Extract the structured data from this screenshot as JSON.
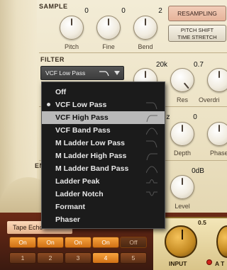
{
  "sample": {
    "section_label": "SAMPLE",
    "knobs": [
      {
        "label": "Pitch",
        "value": "0"
      },
      {
        "label": "Fine",
        "value": "0"
      },
      {
        "label": "Bend",
        "value": "2"
      }
    ],
    "resampling_label": "RESAMPLING",
    "pitch_shift_label_1": "PITCH SHIFT",
    "pitch_shift_label_2": "TIME STRETCH"
  },
  "filter": {
    "section_label": "FILTER",
    "selected": "VCF Low Pass",
    "cutoff_value": "20k",
    "res_value": "0.7",
    "res_label": "Res",
    "overdrive_label": "Overdri",
    "options": [
      {
        "label": "Off",
        "checked": false,
        "highlighted": false,
        "icon": "none"
      },
      {
        "label": "VCF Low Pass",
        "checked": true,
        "highlighted": false,
        "icon": "lowpass-curve-icon"
      },
      {
        "label": "VCF High Pass",
        "checked": false,
        "highlighted": true,
        "icon": "highpass-curve-icon"
      },
      {
        "label": "VCF Band Pass",
        "checked": false,
        "highlighted": false,
        "icon": "bandpass-curve-icon"
      },
      {
        "label": "M Ladder Low Pass",
        "checked": false,
        "highlighted": false,
        "icon": "lowpass-curve-icon"
      },
      {
        "label": "M Ladder High Pass",
        "checked": false,
        "highlighted": false,
        "icon": "highpass-curve-icon"
      },
      {
        "label": "M Ladder Band Pass",
        "checked": false,
        "highlighted": false,
        "icon": "bandpass-curve-icon"
      },
      {
        "label": "Ladder Peak",
        "checked": false,
        "highlighted": false,
        "icon": "peak-curve-icon"
      },
      {
        "label": "Ladder Notch",
        "checked": false,
        "highlighted": false,
        "icon": "notch-curve-icon"
      },
      {
        "label": "Formant",
        "checked": false,
        "highlighted": false,
        "icon": "none"
      },
      {
        "label": "Phaser",
        "checked": false,
        "highlighted": false,
        "icon": "none"
      }
    ]
  },
  "lfo": {
    "section_partial": "z",
    "depth_value": "0",
    "depth_label": "Depth",
    "phase_label": "Phase"
  },
  "envelope": {
    "section_partial": "EN",
    "level_value": "0dB",
    "level_label": "Level"
  },
  "fx": {
    "tape_label": "Tape Echo",
    "on_buttons": [
      "On",
      "On",
      "On",
      "On",
      "Off"
    ],
    "on_states": [
      true,
      true,
      true,
      true,
      false
    ],
    "slots": [
      "1",
      "2",
      "3",
      "4",
      "5"
    ],
    "selected_slot": "4"
  },
  "amp": {
    "input_value": "0.5",
    "input_label": "INPUT",
    "a_label": "A T"
  },
  "colors": {
    "accent_orange": "#e8892a",
    "dropdown_bg": "#1b1b1b",
    "highlight": "#b9b9b9"
  }
}
